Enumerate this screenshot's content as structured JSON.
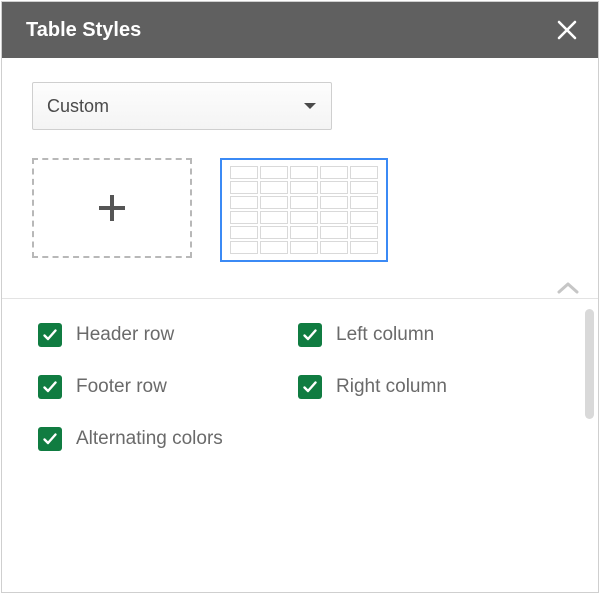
{
  "title": "Table Styles",
  "dropdown": {
    "selected": "Custom"
  },
  "options": {
    "header_row": {
      "label": "Header row",
      "checked": true
    },
    "footer_row": {
      "label": "Footer row",
      "checked": true
    },
    "alt_colors": {
      "label": "Alternating colors",
      "checked": true
    },
    "left_column": {
      "label": "Left column",
      "checked": true
    },
    "right_column": {
      "label": "Right column",
      "checked": true
    }
  },
  "colors": {
    "accent_check": "#107c41",
    "selection": "#3b8af5",
    "header_bg": "#606060"
  }
}
